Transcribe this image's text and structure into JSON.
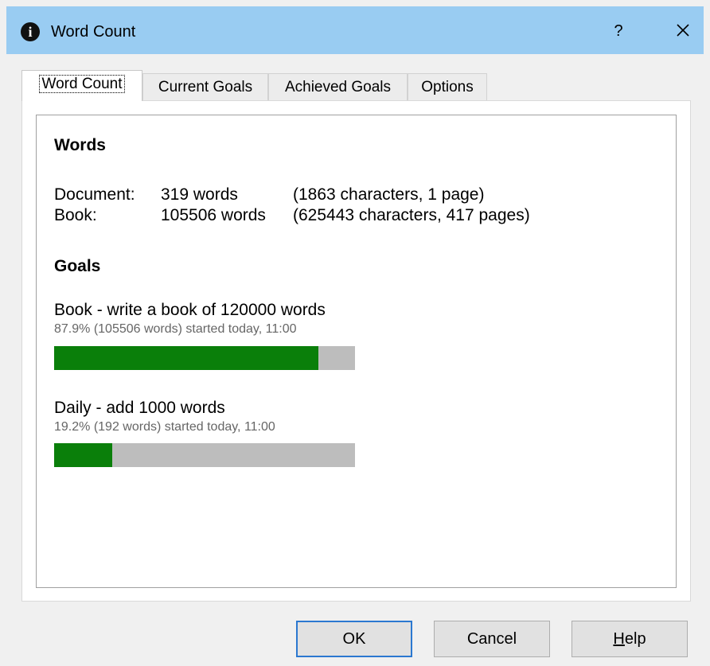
{
  "window": {
    "title": "Word Count",
    "help_glyph": "?",
    "icon": "info-icon"
  },
  "tabs": [
    {
      "label": "Word Count",
      "active": true
    },
    {
      "label": "Current Goals",
      "active": false
    },
    {
      "label": "Achieved Goals",
      "active": false
    },
    {
      "label": "Options",
      "active": false
    }
  ],
  "words": {
    "heading": "Words",
    "rows": [
      {
        "label": "Document:",
        "count": "319 words",
        "details": "(1863 characters, 1 page)"
      },
      {
        "label": "Book:",
        "count": "105506 words",
        "details": "(625443 characters, 417 pages)"
      }
    ]
  },
  "goals": {
    "heading": "Goals",
    "items": [
      {
        "title": "Book - write a book of 120000 words",
        "subtitle": "87.9% (105506 words) started today, 11:00",
        "progress": 0.879
      },
      {
        "title": "Daily - add 1000 words",
        "subtitle": "19.2% (192 words) started today, 11:00",
        "progress": 0.192
      }
    ]
  },
  "buttons": {
    "ok": "OK",
    "cancel": "Cancel",
    "help_prefix": "H",
    "help_rest": "elp"
  },
  "colors": {
    "titlebar": "#99ccf2",
    "progress_fill": "#0a7f0a",
    "progress_track": "#bdbdbd"
  }
}
